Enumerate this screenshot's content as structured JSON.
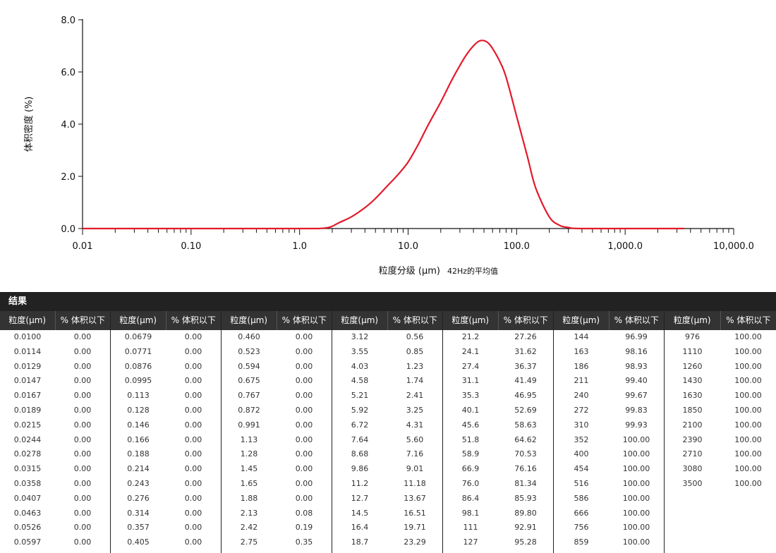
{
  "chart_data": {
    "type": "line",
    "xscale": "log",
    "xlim": [
      0.01,
      10000
    ],
    "ylim": [
      0,
      8
    ],
    "xlabel": "粒度分级 (μm)",
    "xlabel_note": "42Hz的平均值",
    "ylabel": "体积密度 (%)",
    "x_ticks": [
      0.01,
      0.1,
      1,
      10,
      100,
      1000,
      10000
    ],
    "x_tick_labels": [
      "0.01",
      "0.10",
      "1.0",
      "10.0",
      "100.0",
      "1,000.0",
      "10,000.0"
    ],
    "y_ticks": [
      0,
      2,
      4,
      6,
      8
    ],
    "y_tick_labels": [
      "0.0",
      "2.0",
      "4.0",
      "6.0",
      "8.0"
    ],
    "line_color": "#e31a2a",
    "series": [
      {
        "x": [
          0.01,
          0.1,
          1.0,
          1.5,
          1.9,
          2.3,
          3.0,
          4.0,
          5.0,
          6.5,
          8.0,
          10.0,
          12.5,
          15.0,
          20.0,
          25.0,
          30.0,
          35.0,
          40.0,
          45.0,
          50.0,
          55.0,
          60.0,
          70.0,
          80.0,
          100.0,
          125.0,
          150.0,
          200.0,
          250.0,
          300.0,
          380.0,
          1000.0,
          3500.0
        ],
        "y": [
          0,
          0,
          0,
          0,
          0.05,
          0.22,
          0.45,
          0.8,
          1.15,
          1.65,
          2.05,
          2.55,
          3.25,
          3.9,
          4.85,
          5.65,
          6.25,
          6.7,
          7.0,
          7.18,
          7.2,
          7.1,
          6.9,
          6.4,
          5.8,
          4.3,
          2.8,
          1.55,
          0.45,
          0.12,
          0.04,
          0,
          0,
          0
        ]
      }
    ]
  },
  "results": {
    "title": "结果",
    "header_size": "粒度(μm)",
    "header_pct": "% 体积以下",
    "columns": [
      {
        "size": [
          "0.0100",
          "0.0114",
          "0.0129",
          "0.0147",
          "0.0167",
          "0.0189",
          "0.0215",
          "0.0244",
          "0.0278",
          "0.0315",
          "0.0358",
          "0.0407",
          "0.0463",
          "0.0526",
          "0.0597"
        ],
        "pct": [
          "0.00",
          "0.00",
          "0.00",
          "0.00",
          "0.00",
          "0.00",
          "0.00",
          "0.00",
          "0.00",
          "0.00",
          "0.00",
          "0.00",
          "0.00",
          "0.00",
          "0.00"
        ]
      },
      {
        "size": [
          "0.0679",
          "0.0771",
          "0.0876",
          "0.0995",
          "0.113",
          "0.128",
          "0.146",
          "0.166",
          "0.188",
          "0.214",
          "0.243",
          "0.276",
          "0.314",
          "0.357",
          "0.405"
        ],
        "pct": [
          "0.00",
          "0.00",
          "0.00",
          "0.00",
          "0.00",
          "0.00",
          "0.00",
          "0.00",
          "0.00",
          "0.00",
          "0.00",
          "0.00",
          "0.00",
          "0.00",
          "0.00"
        ]
      },
      {
        "size": [
          "0.460",
          "0.523",
          "0.594",
          "0.675",
          "0.767",
          "0.872",
          "0.991",
          "1.13",
          "1.28",
          "1.45",
          "1.65",
          "1.88",
          "2.13",
          "2.42",
          "2.75"
        ],
        "pct": [
          "0.00",
          "0.00",
          "0.00",
          "0.00",
          "0.00",
          "0.00",
          "0.00",
          "0.00",
          "0.00",
          "0.00",
          "0.00",
          "0.00",
          "0.08",
          "0.19",
          "0.35"
        ]
      },
      {
        "size": [
          "3.12",
          "3.55",
          "4.03",
          "4.58",
          "5.21",
          "5.92",
          "6.72",
          "7.64",
          "8.68",
          "9.86",
          "11.2",
          "12.7",
          "14.5",
          "16.4",
          "18.7"
        ],
        "pct": [
          "0.56",
          "0.85",
          "1.23",
          "1.74",
          "2.41",
          "3.25",
          "4.31",
          "5.60",
          "7.16",
          "9.01",
          "11.18",
          "13.67",
          "16.51",
          "19.71",
          "23.29"
        ]
      },
      {
        "size": [
          "21.2",
          "24.1",
          "27.4",
          "31.1",
          "35.3",
          "40.1",
          "45.6",
          "51.8",
          "58.9",
          "66.9",
          "76.0",
          "86.4",
          "98.1",
          "111",
          "127"
        ],
        "pct": [
          "27.26",
          "31.62",
          "36.37",
          "41.49",
          "46.95",
          "52.69",
          "58.63",
          "64.62",
          "70.53",
          "76.16",
          "81.34",
          "85.93",
          "89.80",
          "92.91",
          "95.28"
        ]
      },
      {
        "size": [
          "144",
          "163",
          "186",
          "211",
          "240",
          "272",
          "310",
          "352",
          "400",
          "454",
          "516",
          "586",
          "666",
          "756",
          "859"
        ],
        "pct": [
          "96.99",
          "98.16",
          "98.93",
          "99.40",
          "99.67",
          "99.83",
          "99.93",
          "100.00",
          "100.00",
          "100.00",
          "100.00",
          "100.00",
          "100.00",
          "100.00",
          "100.00"
        ]
      },
      {
        "size": [
          "976",
          "1110",
          "1260",
          "1430",
          "1630",
          "1850",
          "2100",
          "2390",
          "2710",
          "3080",
          "3500"
        ],
        "pct": [
          "100.00",
          "100.00",
          "100.00",
          "100.00",
          "100.00",
          "100.00",
          "100.00",
          "100.00",
          "100.00",
          "100.00",
          "100.00"
        ]
      }
    ]
  }
}
